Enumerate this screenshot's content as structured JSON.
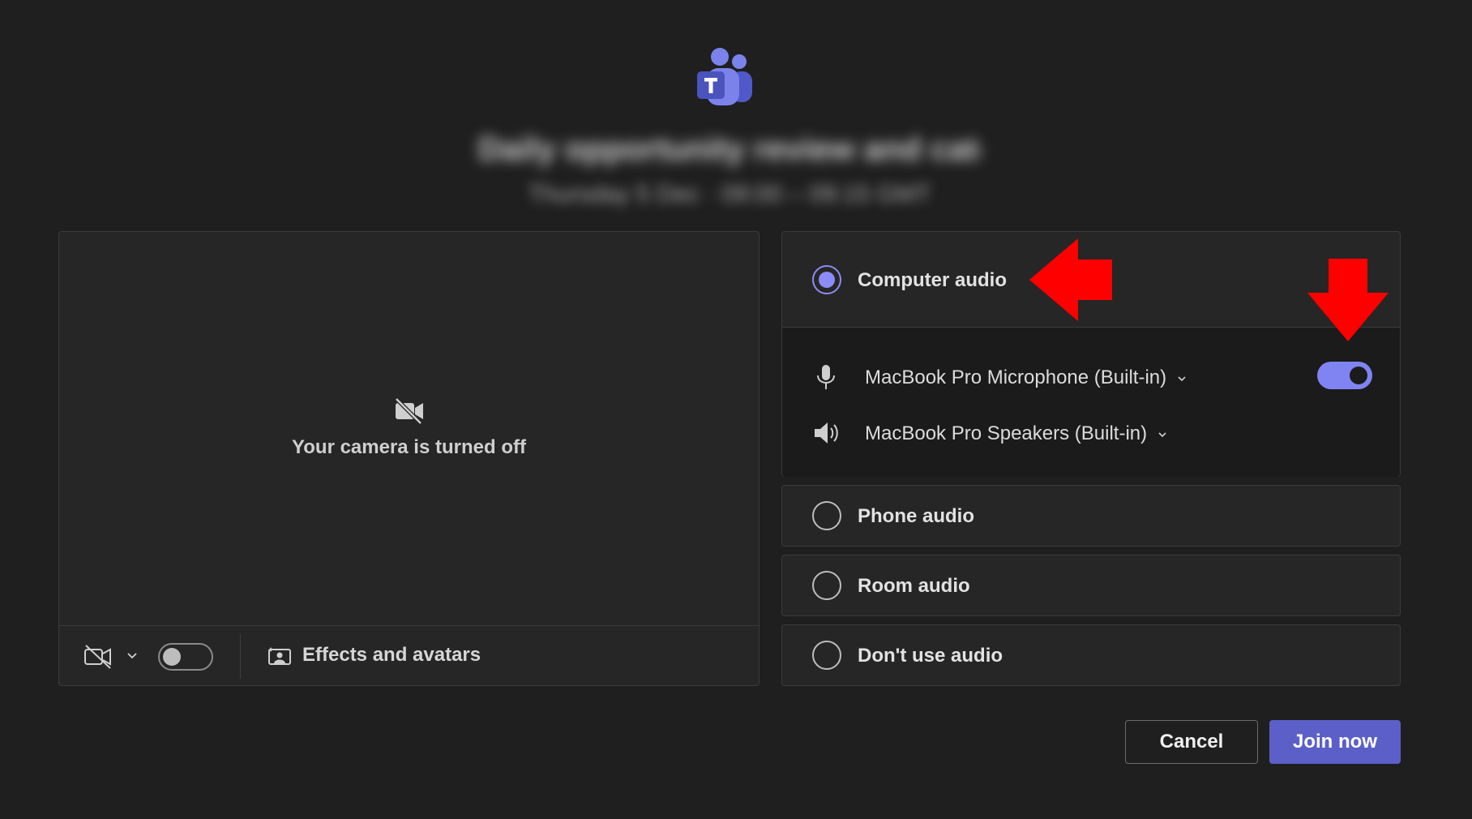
{
  "header": {
    "app_logo": "microsoft-teams-logo",
    "meeting_title": "Daily opportunity review and catch-up",
    "meeting_time": "Thursday 5 Dec · 09:00 – 09:15 GMT"
  },
  "camera": {
    "status_text": "Your camera is turned off",
    "toggle_on": false,
    "effects_label": "Effects and avatars"
  },
  "audio": {
    "options": {
      "computer": {
        "label": "Computer audio",
        "selected": true
      },
      "phone": {
        "label": "Phone audio",
        "selected": false
      },
      "room": {
        "label": "Room audio",
        "selected": false
      },
      "none": {
        "label": "Don't use audio",
        "selected": false
      }
    },
    "microphone": {
      "label": "MacBook Pro Microphone (Built-in)",
      "enabled": true
    },
    "speakers": {
      "label": "MacBook Pro Speakers (Built-in)"
    }
  },
  "buttons": {
    "cancel": "Cancel",
    "join": "Join now"
  },
  "colors": {
    "accent": "#7f84f2",
    "join_button": "#5b5fc7",
    "annotation_arrow": "#ff0000",
    "background": "#1f1f1f"
  }
}
